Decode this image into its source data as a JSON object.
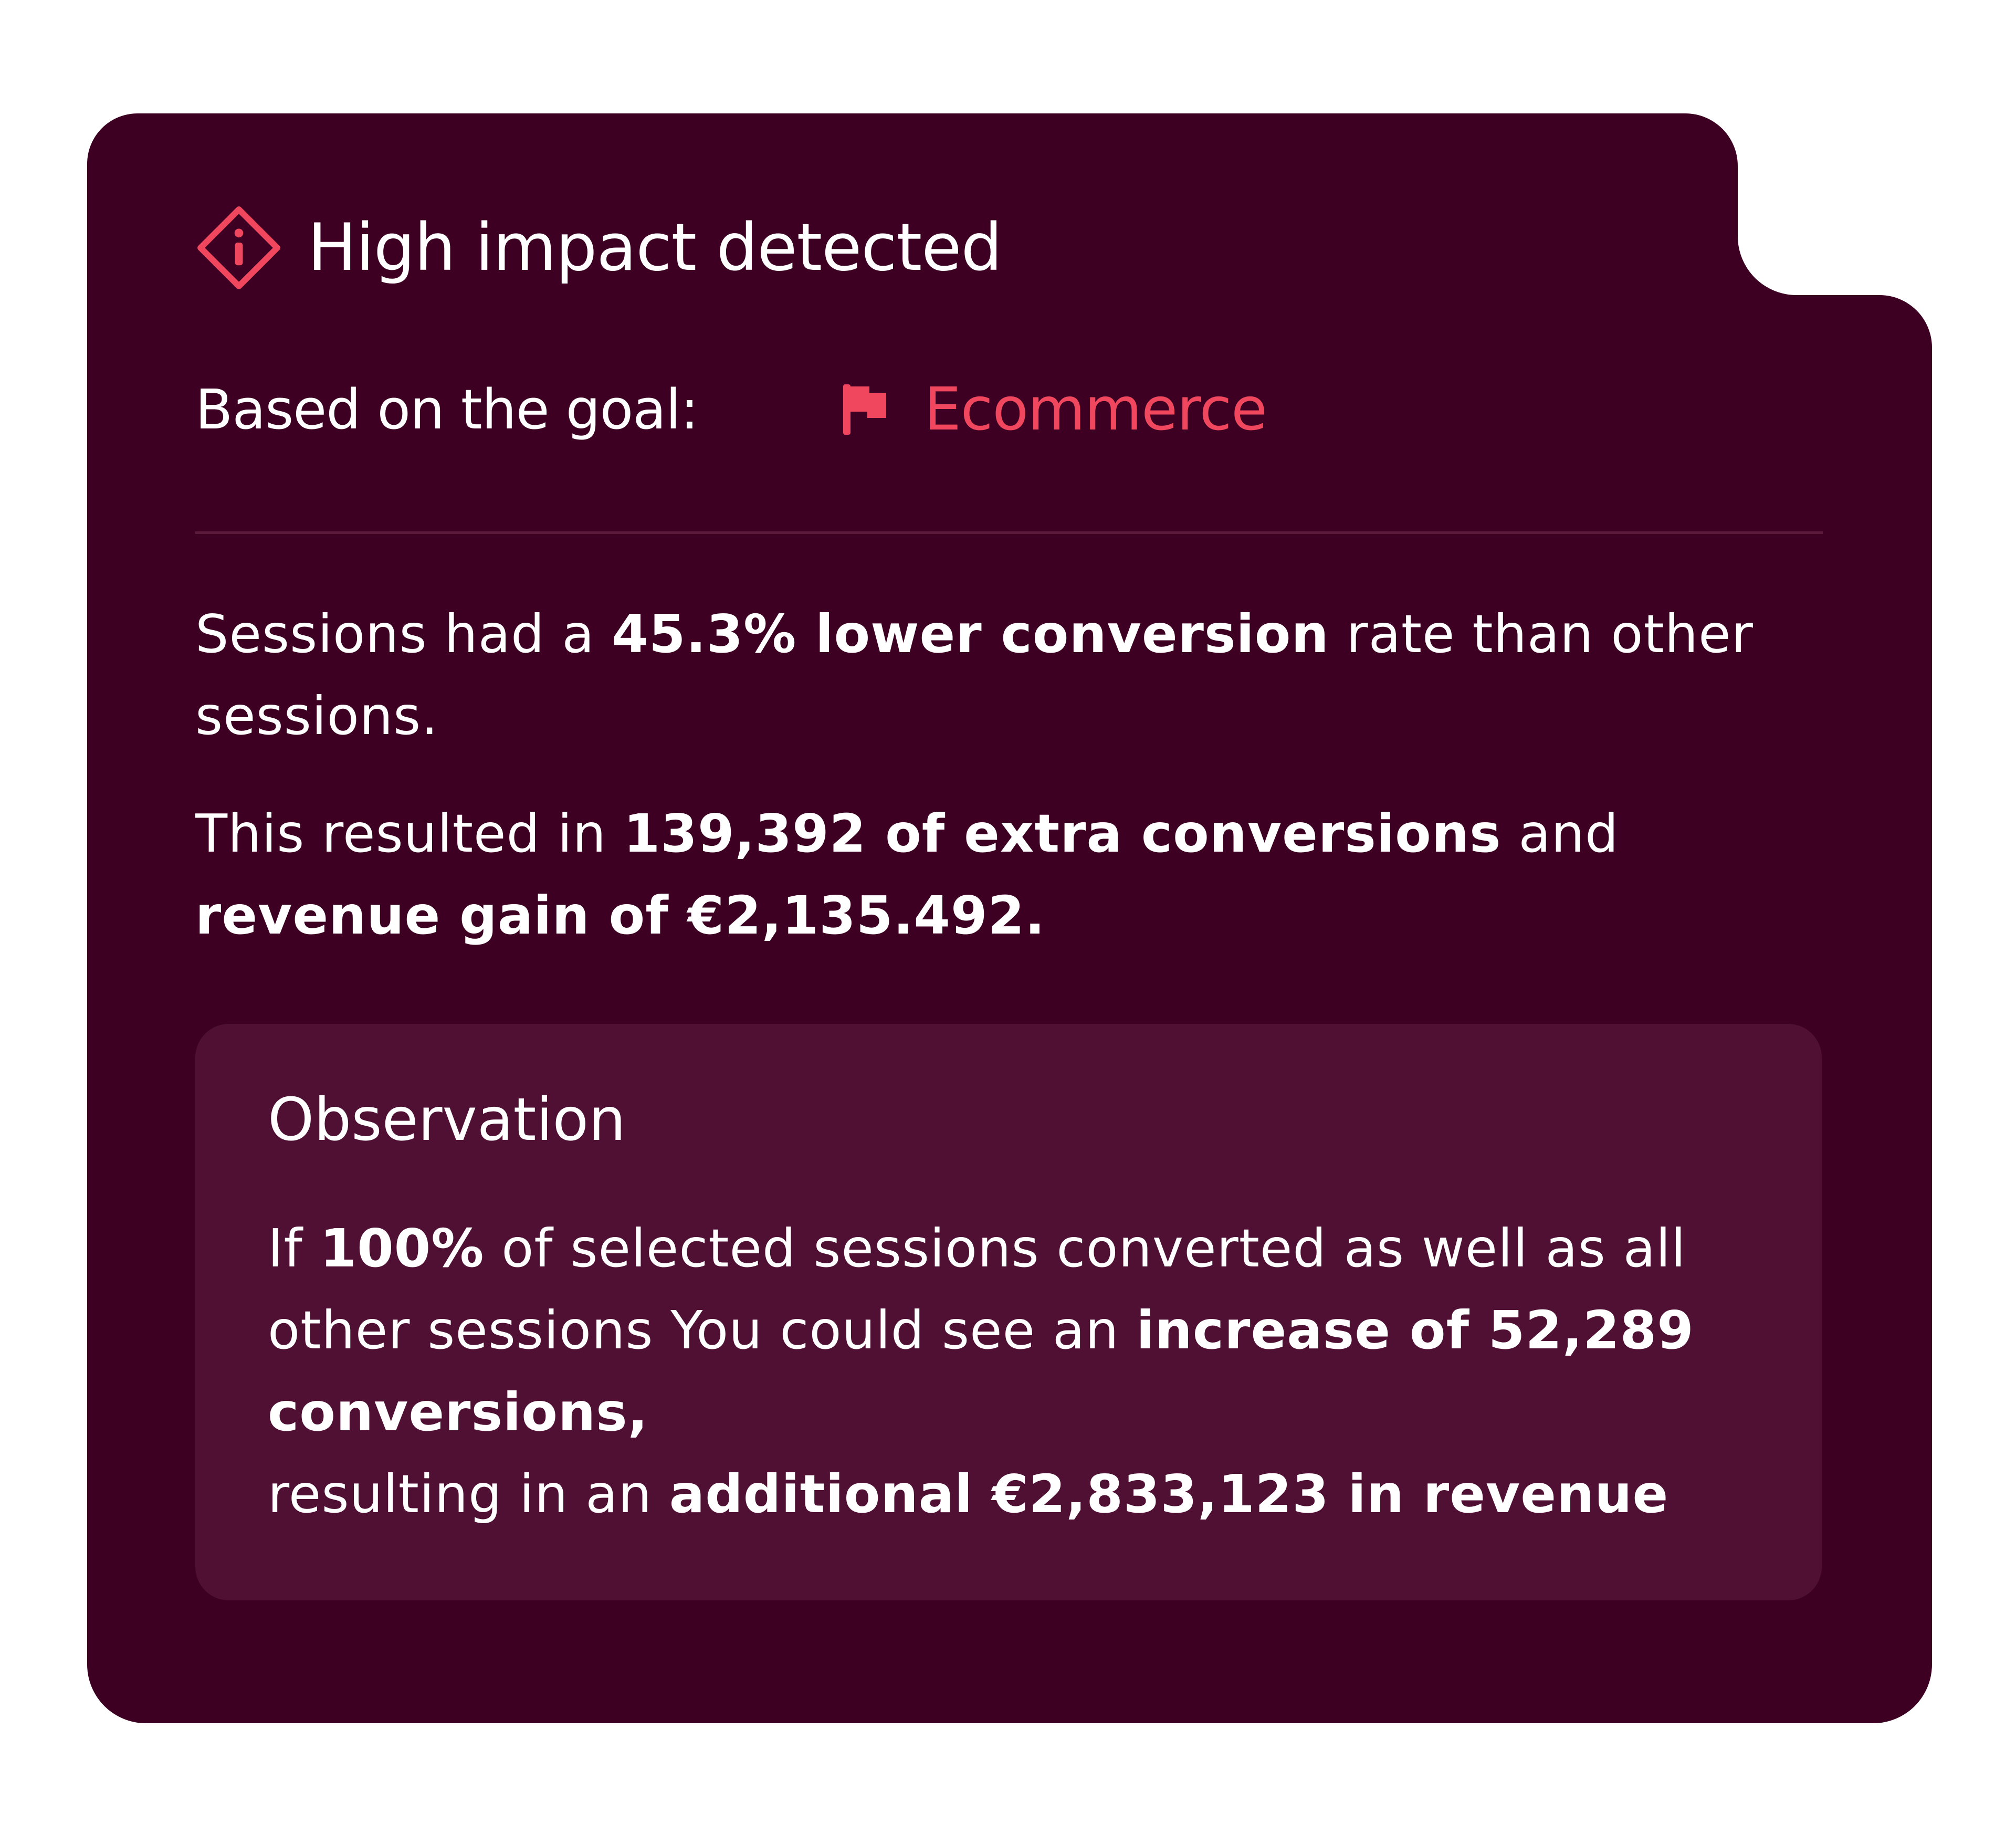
{
  "colors": {
    "card_background": "#3d0022",
    "observation_background": "#4f1033",
    "accent": "#f0475f",
    "divider": "#5b1a3a",
    "text": "#ffffff"
  },
  "header": {
    "icon": "info-diamond-icon",
    "title": "High impact detected"
  },
  "goal": {
    "label": "Based on the goal:",
    "icon": "flag-icon",
    "value": "Ecommerce"
  },
  "summary": {
    "conversion": {
      "prefix": "Sessions had a ",
      "highlight": "45.3% lower conversion",
      "suffix": " rate than other sessions."
    },
    "result": {
      "prefix": "This resulted in ",
      "highlight1": "139,392 of extra conversions",
      "middle": " and ",
      "highlight2": "revenue gain of €2,135.492."
    }
  },
  "observation": {
    "title": "Observation",
    "text": {
      "prefix": "If ",
      "highlight1": "100%",
      "middle": " of selected sessions converted as well as all other sessions You could see an ",
      "highlight2": "increase of 52,289 conversions,",
      "middle2": "resulting in an ",
      "highlight3": "additional €2,833,123 in revenue"
    }
  }
}
